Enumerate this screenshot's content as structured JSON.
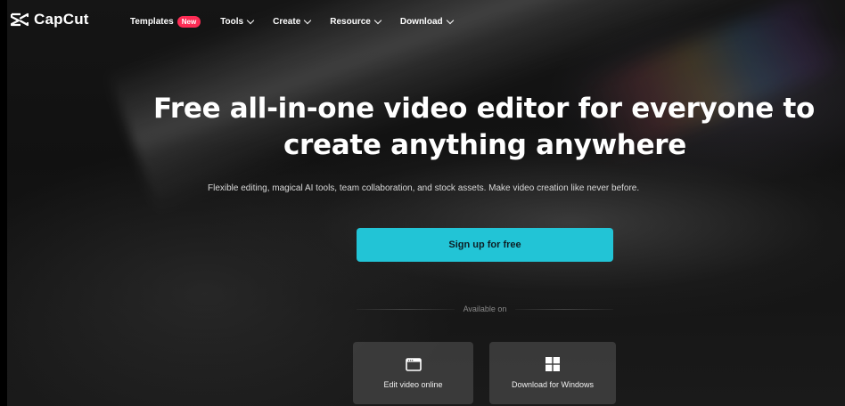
{
  "brand": {
    "name": "CapCut"
  },
  "nav": {
    "items": [
      {
        "label": "Templates",
        "badge": "New",
        "has_dropdown": false
      },
      {
        "label": "Tools",
        "has_dropdown": true
      },
      {
        "label": "Create",
        "has_dropdown": true
      },
      {
        "label": "Resource",
        "has_dropdown": true
      },
      {
        "label": "Download",
        "has_dropdown": true
      }
    ]
  },
  "hero": {
    "title_line1": "Free all-in-one video editor for everyone to",
    "title_line2": "create anything anywhere",
    "subtitle": "Flexible editing, magical AI tools, team collaboration, and stock assets. Make video creation like never before.",
    "cta_label": "Sign up for free"
  },
  "platforms": {
    "heading": "Available on",
    "options": [
      {
        "label": "Edit video online",
        "icon": "browser-window-icon"
      },
      {
        "label": "Download for Windows",
        "icon": "windows-logo-icon"
      }
    ]
  },
  "colors": {
    "accent": "#22c4d6",
    "badge": "#fe2c55",
    "background": "#111111"
  }
}
